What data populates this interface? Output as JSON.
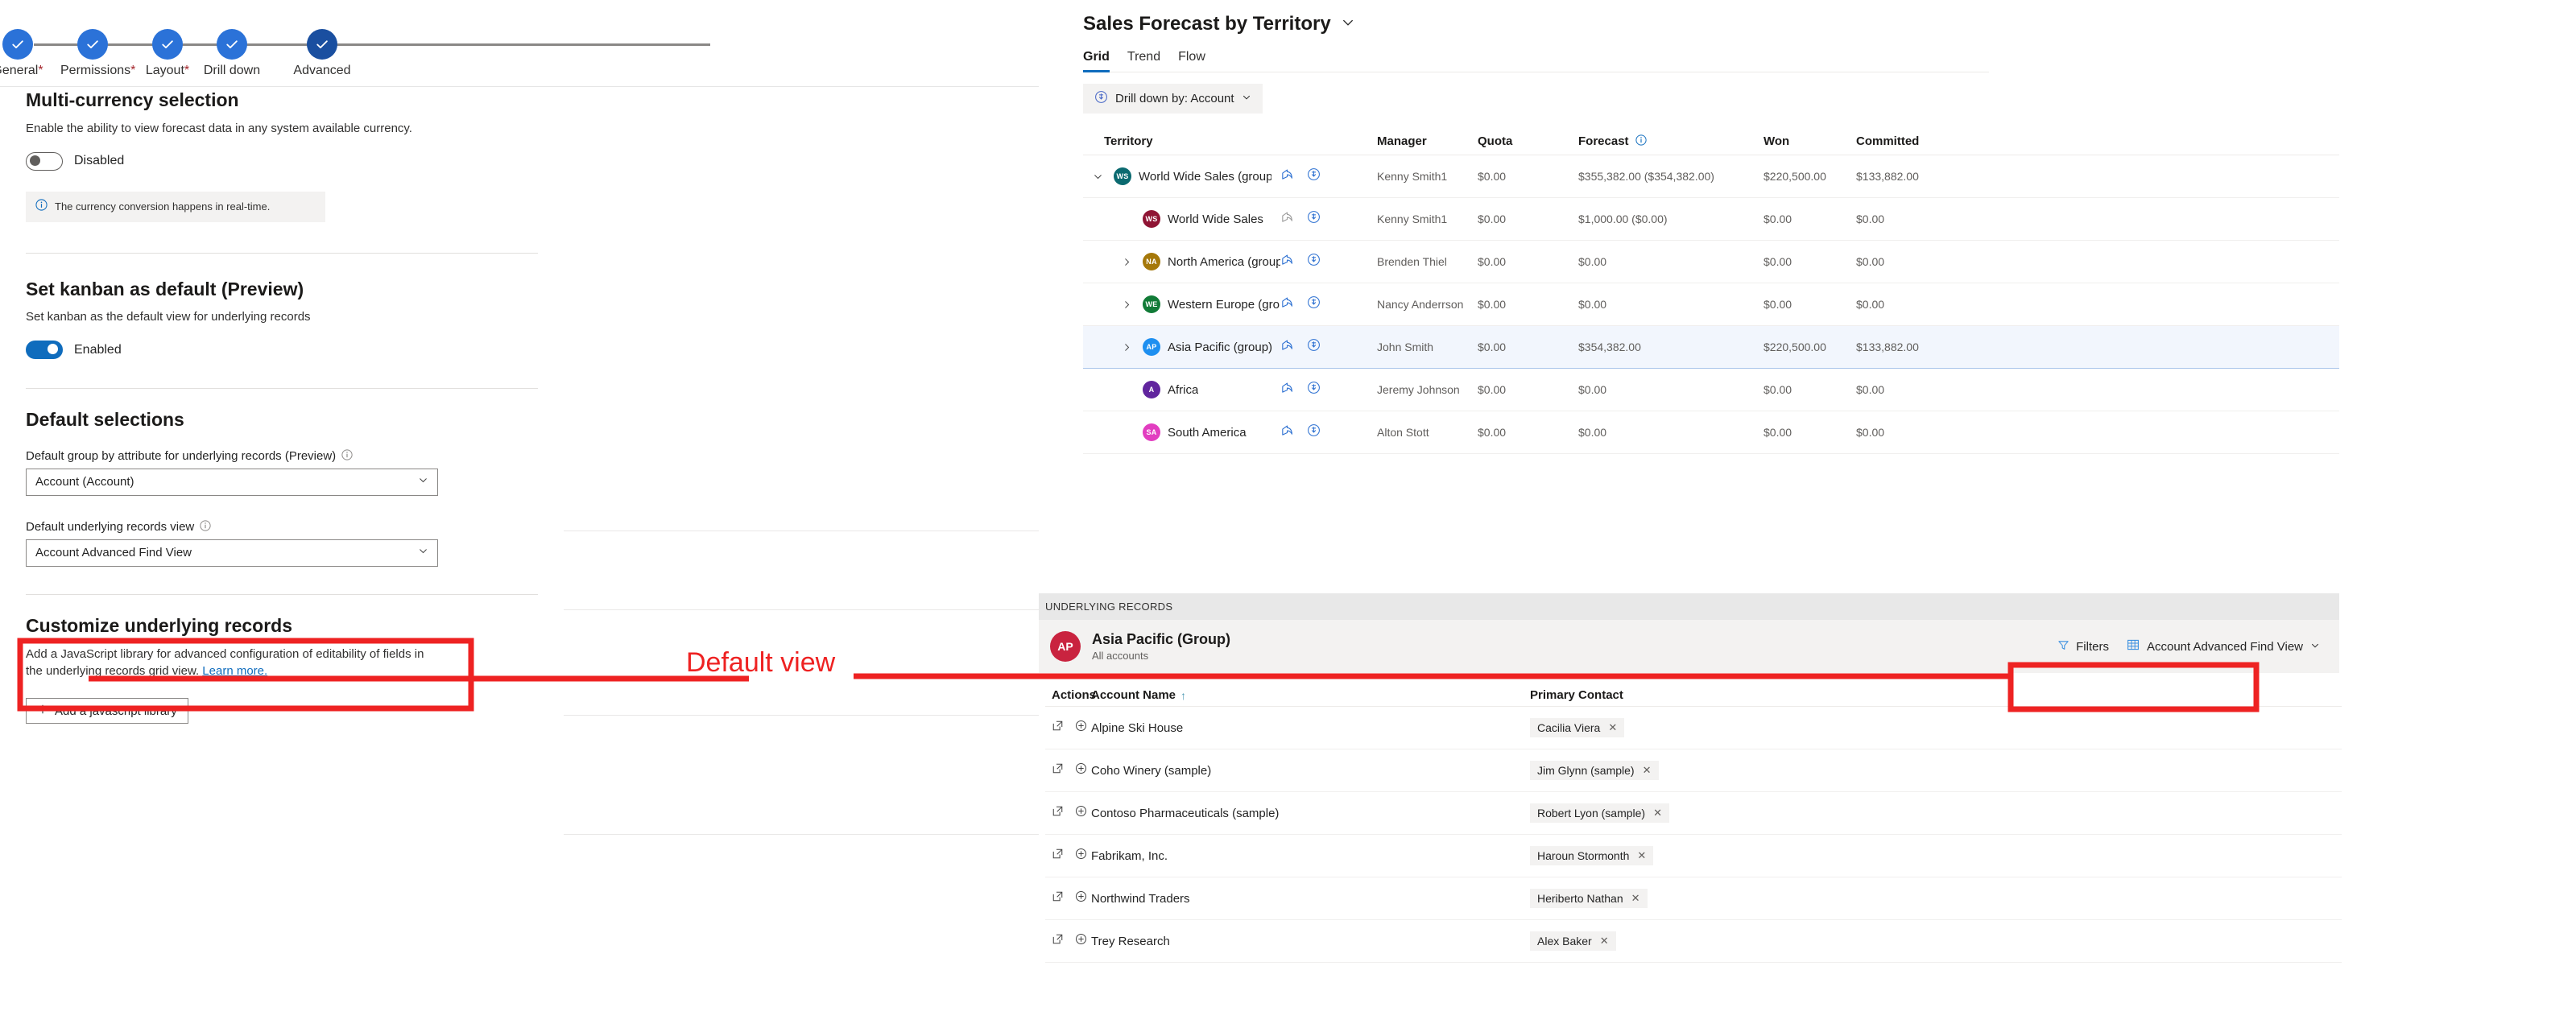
{
  "wizard": {
    "steps": [
      {
        "label": "General",
        "required": true,
        "state": "done"
      },
      {
        "label": "Permissions",
        "required": true,
        "state": "done"
      },
      {
        "label": "Layout",
        "required": true,
        "state": "done"
      },
      {
        "label": "Drill down",
        "required": false,
        "state": "done"
      },
      {
        "label": "Advanced",
        "required": false,
        "state": "current"
      }
    ]
  },
  "settings": {
    "multicurrency": {
      "title": "Multi-currency selection",
      "description": "Enable the ability to view forecast data in any system available currency.",
      "toggle_state": "off",
      "toggle_label": "Disabled",
      "info_text": "The currency conversion happens in real-time."
    },
    "kanban": {
      "title": "Set kanban as default (Preview)",
      "description": "Set kanban as the default view for underlying records",
      "toggle_state": "on",
      "toggle_label": "Enabled"
    },
    "default_selections": {
      "title": "Default selections",
      "group_by": {
        "label": "Default group by attribute for underlying records (Preview)",
        "value": "Account (Account)"
      },
      "records_view": {
        "label": "Default underlying records view",
        "value": "Account Advanced Find View"
      }
    },
    "customize": {
      "title": "Customize underlying records",
      "description_pre": "Add a JavaScript library for advanced configuration of editability of fields in the underlying records grid view.",
      "link_text": "Learn more.",
      "button_label": "Add a javascript library"
    }
  },
  "annotation": {
    "text": "Default view",
    "color": "#ee2222"
  },
  "forecast": {
    "title": "Sales Forecast by Territory",
    "tabs": [
      {
        "label": "Grid",
        "active": true
      },
      {
        "label": "Trend",
        "active": false
      },
      {
        "label": "Flow",
        "active": false
      }
    ],
    "drill_down_label": "Drill down by: Account",
    "columns": [
      "Territory",
      "Manager",
      "Quota",
      "Forecast",
      "Won",
      "Committed"
    ],
    "rows": [
      {
        "territory": "World Wide Sales (group)",
        "initials": "WS",
        "color": "#0b6a70",
        "indent": 0,
        "expander": "expanded",
        "manager": "Kenny Smith1",
        "quota": "$0.00",
        "forecast": "$355,382.00 ($354,382.00)",
        "won": "$220,500.00",
        "committed": "$133,882.00",
        "selected": false,
        "share_active": true
      },
      {
        "territory": "World Wide Sales",
        "initials": "WS",
        "color": "#8f1434",
        "indent": 1,
        "expander": "none",
        "manager": "Kenny Smith1",
        "quota": "$0.00",
        "forecast": "$1,000.00 ($0.00)",
        "won": "$0.00",
        "committed": "$0.00",
        "selected": false,
        "share_active": false
      },
      {
        "territory": "North America (group)",
        "initials": "NA",
        "color": "#a5780a",
        "indent": 1,
        "expander": "collapsed",
        "manager": "Brenden Thiel",
        "quota": "$0.00",
        "forecast": "$0.00",
        "won": "$0.00",
        "committed": "$0.00",
        "selected": false,
        "share_active": true
      },
      {
        "territory": "Western Europe (group)",
        "initials": "WE",
        "color": "#117b37",
        "indent": 1,
        "expander": "collapsed",
        "manager": "Nancy Anderrson",
        "quota": "$0.00",
        "forecast": "$0.00",
        "won": "$0.00",
        "committed": "$0.00",
        "selected": false,
        "share_active": true
      },
      {
        "territory": "Asia Pacific (group)",
        "initials": "AP",
        "color": "#1e8ff0",
        "indent": 1,
        "expander": "collapsed",
        "manager": "John Smith",
        "quota": "$0.00",
        "forecast": "$354,382.00",
        "won": "$220,500.00",
        "committed": "$133,882.00",
        "selected": true,
        "share_active": true
      },
      {
        "territory": "Africa",
        "initials": "A",
        "color": "#61259e",
        "indent": 1,
        "expander": "none",
        "manager": "Jeremy Johnson",
        "quota": "$0.00",
        "forecast": "$0.00",
        "won": "$0.00",
        "committed": "$0.00",
        "selected": false,
        "share_active": true
      },
      {
        "territory": "South America",
        "initials": "SA",
        "color": "#e23ec0",
        "indent": 1,
        "expander": "none",
        "manager": "Alton Stott",
        "quota": "$0.00",
        "forecast": "$0.00",
        "won": "$0.00",
        "committed": "$0.00",
        "selected": false,
        "share_active": true
      }
    ]
  },
  "underlying": {
    "band_label": "UNDERLYING RECORDS",
    "avatar_initials": "AP",
    "avatar_color": "#c9233f",
    "record_name": "Asia Pacific (Group)",
    "record_sub": "All accounts",
    "filters_label": "Filters",
    "view_label": "Account Advanced Find View",
    "columns": [
      "Actions",
      "Account Name",
      "Primary Contact"
    ],
    "sort_column": "Account Name",
    "sort_direction": "asc",
    "rows": [
      {
        "account": "Alpine Ski House",
        "contact": "Cacilia Viera"
      },
      {
        "account": "Coho Winery (sample)",
        "contact": "Jim Glynn (sample)"
      },
      {
        "account": "Contoso Pharmaceuticals (sample)",
        "contact": "Robert Lyon (sample)"
      },
      {
        "account": "Fabrikam, Inc.",
        "contact": "Haroun Stormonth"
      },
      {
        "account": "Northwind Traders",
        "contact": "Heriberto Nathan"
      },
      {
        "account": "Trey Research",
        "contact": "Alex Baker"
      }
    ]
  },
  "icons": {
    "check": "check-icon",
    "chevron_down": "chevron-down-icon",
    "chevron_right": "chevron-right-icon",
    "info": "info-icon",
    "share": "share-icon",
    "drill": "drill-down-icon",
    "filter": "filter-icon",
    "grid": "grid-view-icon",
    "open": "open-record-icon",
    "expand": "expand-record-icon",
    "plus": "plus-icon",
    "close": "close-icon",
    "sort_asc": "sort-ascending-icon"
  },
  "colors": {
    "accent": "#0f6cbd",
    "step_done": "#2b72d8",
    "step_current": "#1a4fa0",
    "annotation": "#ee2222",
    "selected_row": "#f2f6fd"
  }
}
